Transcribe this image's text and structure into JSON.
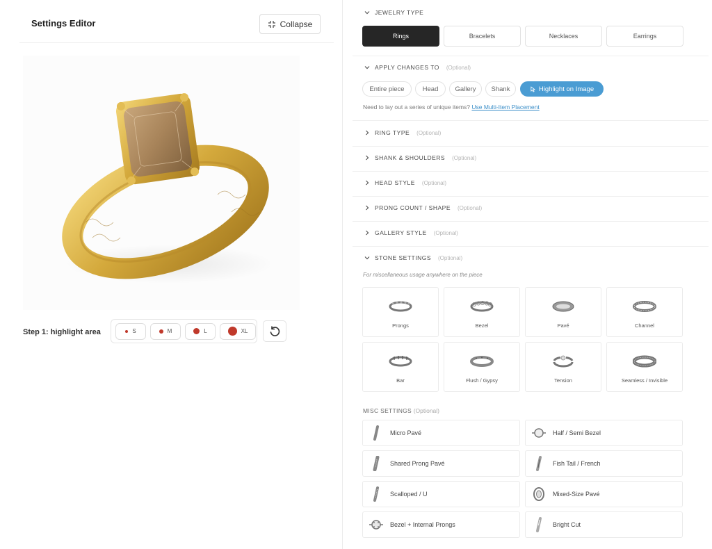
{
  "editor": {
    "title": "Settings Editor",
    "collapse_label": "Collapse",
    "step_label": "Step 1: highlight area",
    "brush_sizes": [
      "S",
      "M",
      "L",
      "XL"
    ],
    "brush_color": "#c0392b"
  },
  "jewelry_type": {
    "heading": "JEWELRY TYPE",
    "options": [
      "Rings",
      "Bracelets",
      "Necklaces",
      "Earrings"
    ],
    "selected": "Rings"
  },
  "apply_changes": {
    "heading": "APPLY CHANGES TO",
    "optional": "(Optional)",
    "options": [
      "Entire piece",
      "Head",
      "Gallery",
      "Shank"
    ],
    "highlight_label": "Highlight on Image",
    "hint_text": "Need to lay out a series of unique items?",
    "hint_link": "Use Multi-Item Placement"
  },
  "collapsed_sections": [
    {
      "heading": "RING TYPE",
      "optional": "(Optional)"
    },
    {
      "heading": "SHANK & SHOULDERS",
      "optional": "(Optional)"
    },
    {
      "heading": "HEAD STYLE",
      "optional": "(Optional)"
    },
    {
      "heading": "PRONG COUNT / SHAPE",
      "optional": "(Optional)"
    },
    {
      "heading": "GALLERY STYLE",
      "optional": "(Optional)"
    }
  ],
  "stone_settings": {
    "heading": "STONE SETTINGS",
    "optional": "(Optional)",
    "note": "For miscellaneous usage anywhere on the piece",
    "options": [
      "Prongs",
      "Bezel",
      "Pavé",
      "Channel",
      "Bar",
      "Flush / Gypsy",
      "Tension",
      "Seamless / Invisible"
    ]
  },
  "misc_settings": {
    "heading": "MISC SETTINGS",
    "optional": "(Optional)",
    "options": [
      "Micro Pavé",
      "Half / Semi Bezel",
      "Shared Prong Pavé",
      "Fish Tail / French",
      "Scalloped / U",
      "Mixed-Size Pavé",
      "Bezel + Internal Prongs",
      "Bright Cut"
    ]
  },
  "colors": {
    "accent": "#4a9cd3",
    "active_button": "#262626",
    "gold": "#d4a93c"
  }
}
